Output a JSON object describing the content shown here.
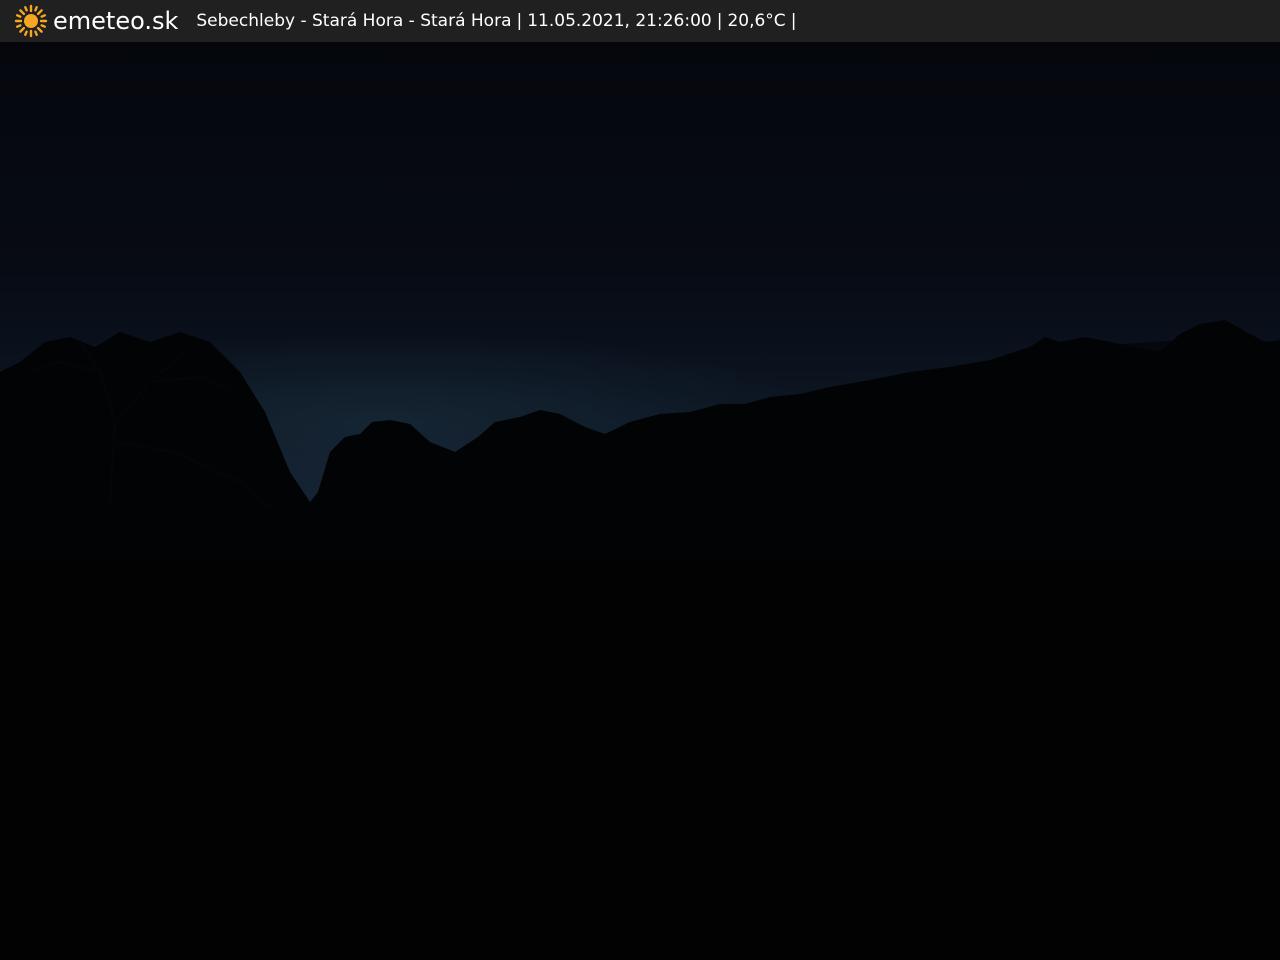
{
  "brand": {
    "name": "emeteo.sk",
    "icon": "sun-icon",
    "icon_color": "#f5a623"
  },
  "caption": {
    "location": "Sebechleby - Stará Hora - Stará Hora",
    "separator": "|",
    "datetime": "11.05.2021, 21:26:00",
    "temperature": "20,6°C"
  },
  "colors": {
    "bar_background": "#202020",
    "sky_top": "#05070d",
    "sky_horizon": "#152536",
    "ground": "#020203"
  }
}
